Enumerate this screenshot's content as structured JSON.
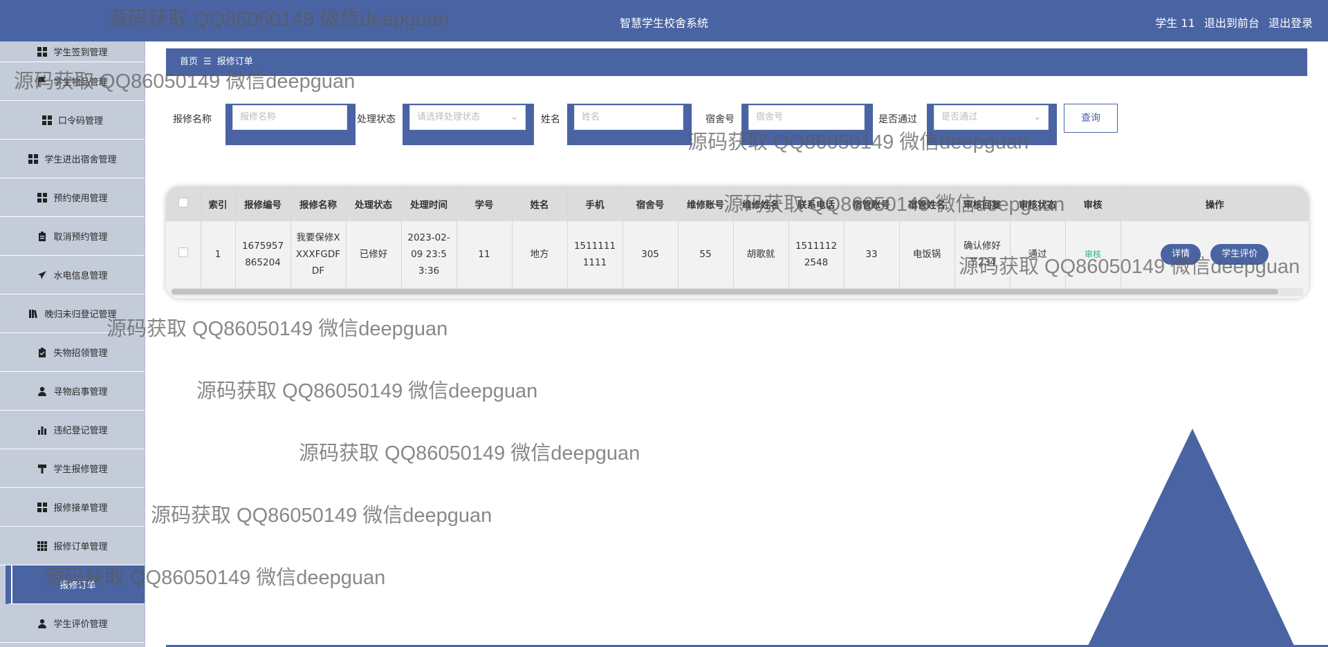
{
  "header": {
    "title": "智慧学生校舍系统",
    "user": "学生 11",
    "links": [
      "退出到前台",
      "退出登录"
    ]
  },
  "sidebar": {
    "items": [
      {
        "label": "学生签到管理",
        "icon": "grid-icon"
      },
      {
        "label": "学生物品管理",
        "icon": "flag-icon"
      },
      {
        "label": "口令码管理",
        "icon": "grid-icon"
      },
      {
        "label": "学生进出宿舍管理",
        "icon": "grid-icon"
      },
      {
        "label": "预约使用管理",
        "icon": "grid-icon"
      },
      {
        "label": "取消预约管理",
        "icon": "clipboard-icon"
      },
      {
        "label": "水电信息管理",
        "icon": "send-icon"
      },
      {
        "label": "晚归未归登记管理",
        "icon": "books-icon"
      },
      {
        "label": "失物招领管理",
        "icon": "clipboard-check-icon"
      },
      {
        "label": "寻物启事管理",
        "icon": "user-icon"
      },
      {
        "label": "违纪登记管理",
        "icon": "bar-chart-icon"
      },
      {
        "label": "学生报修管理",
        "icon": "hammer-icon"
      },
      {
        "label": "报修接单管理",
        "icon": "grid-icon"
      },
      {
        "label": "报修订单管理",
        "icon": "grid9-icon"
      },
      {
        "label": "报修订单",
        "icon": "",
        "active": true
      },
      {
        "label": "学生评价管理",
        "icon": "user-icon"
      }
    ]
  },
  "breadcrumb": {
    "home": "首页",
    "sep": "☰",
    "current": "报修订单"
  },
  "search": {
    "fields": [
      {
        "label": "报修名称",
        "placeholder": "报修名称"
      },
      {
        "label": "处理状态",
        "placeholder": "请选择处理状态"
      },
      {
        "label": "姓名",
        "placeholder": "姓名"
      },
      {
        "label": "宿舍号",
        "placeholder": "宿舍号"
      },
      {
        "label": "是否通过",
        "placeholder": "是否通过"
      }
    ],
    "button": "查询"
  },
  "table": {
    "headers": [
      "索引",
      "报修编号",
      "报修名称",
      "处理状态",
      "处理时间",
      "学号",
      "姓名",
      "手机",
      "宿舍号",
      "维修账号",
      "维修姓名",
      "联系电话",
      "宿管账号",
      "宿管姓名",
      "审核回复",
      "审核状态",
      "审核",
      "操作"
    ],
    "rows": [
      {
        "cells": [
          "1",
          "1675957865204",
          "我要保修XXXXFGDF DF",
          "已修好",
          "2023-02-09 23:53:36",
          "11",
          "地方",
          "15111111111",
          "305",
          "55",
          "胡歌就",
          "15111122548",
          "33",
          "电饭锅",
          "确认修好了234",
          "通过",
          "审核"
        ],
        "actions": [
          "详情",
          "学生评价"
        ]
      }
    ]
  },
  "colors": {
    "primary": "#4a64a3",
    "sidebar": "#c4cbd9",
    "success": "#21ba7a"
  },
  "watermark": "源码获取 QQ86050149 微信deepguan"
}
